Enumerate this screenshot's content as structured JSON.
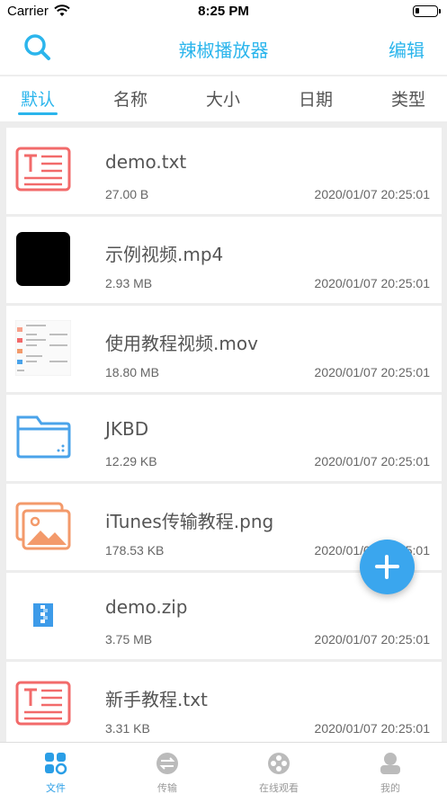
{
  "status_bar": {
    "carrier": "Carrier",
    "time": "8:25 PM"
  },
  "nav": {
    "title": "辣椒播放器",
    "edit_label": "编辑"
  },
  "sort_tabs": [
    {
      "label": "默认",
      "active": true
    },
    {
      "label": "名称",
      "active": false
    },
    {
      "label": "大小",
      "active": false
    },
    {
      "label": "日期",
      "active": false
    },
    {
      "label": "类型",
      "active": false
    }
  ],
  "files": [
    {
      "name": "demo.txt",
      "size": "27.00 B",
      "date": "2020/01/07 20:25:01",
      "icon": "text-file-icon"
    },
    {
      "name": "示例视频.mp4",
      "size": "2.93 MB",
      "date": "2020/01/07 20:25:01",
      "icon": "video-thumbnail"
    },
    {
      "name": "使用教程视频.mov",
      "size": "18.80 MB",
      "date": "2020/01/07 20:25:01",
      "icon": "video-screenshot-thumbnail"
    },
    {
      "name": "JKBD",
      "size": "12.29 KB",
      "date": "2020/01/07 20:25:01",
      "icon": "folder-icon"
    },
    {
      "name": "iTunes传输教程.png",
      "size": "178.53 KB",
      "date": "2020/01/07 20:25:01",
      "icon": "image-file-icon"
    },
    {
      "name": "demo.zip",
      "size": "3.75 MB",
      "date": "2020/01/07 20:25:01",
      "icon": "zip-file-icon"
    },
    {
      "name": "新手教程.txt",
      "size": "3.31 KB",
      "date": "2020/01/07 20:25:01",
      "icon": "text-file-icon"
    }
  ],
  "tab_bar": [
    {
      "label": "文件",
      "icon": "files-icon",
      "active": true
    },
    {
      "label": "传输",
      "icon": "transfer-icon",
      "active": false
    },
    {
      "label": "在线观看",
      "icon": "film-reel-icon",
      "active": false
    },
    {
      "label": "我的",
      "icon": "profile-icon",
      "active": false
    }
  ],
  "colors": {
    "accent": "#2bb5ec",
    "fab": "#3aa6ee",
    "text_icon": "#f26a6a",
    "image_icon": "#f39a6b",
    "folder_icon": "#4aa3ea",
    "zip_icon": "#3d9be9"
  }
}
